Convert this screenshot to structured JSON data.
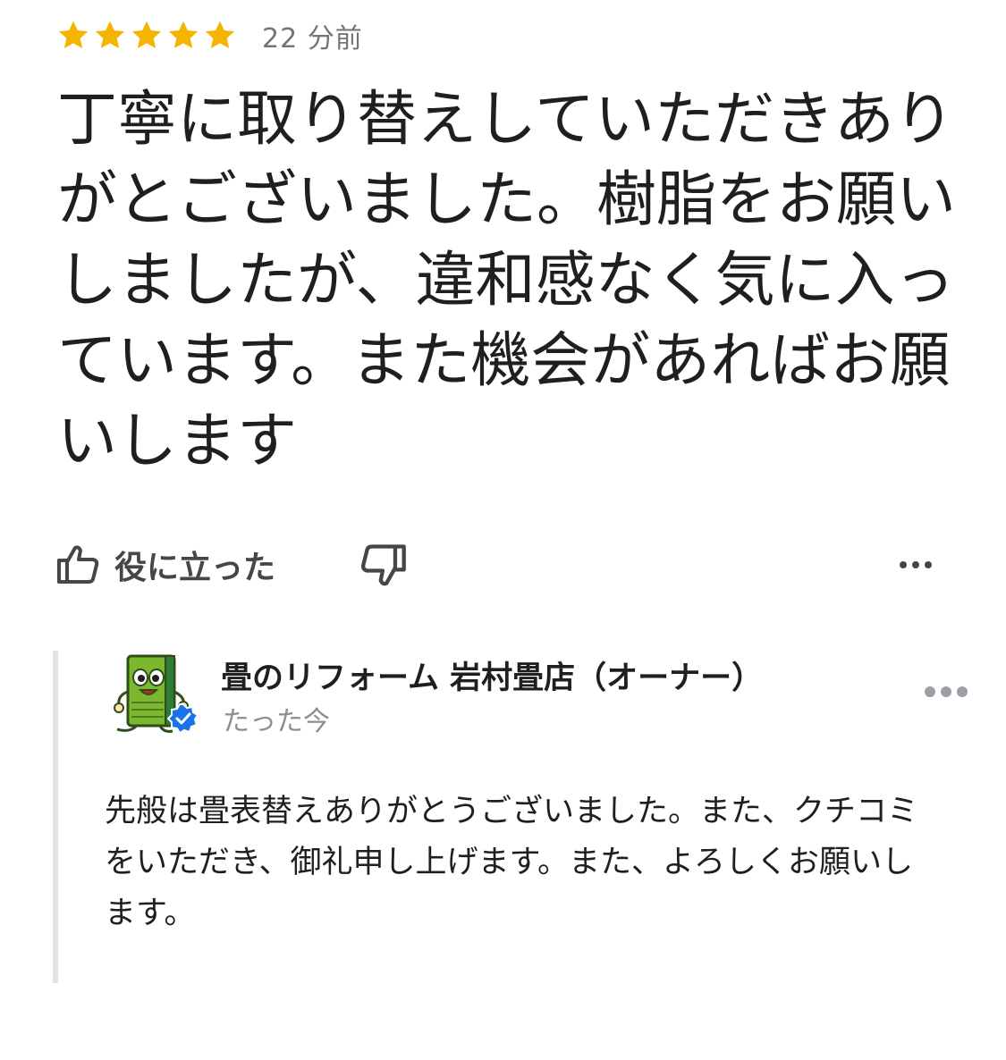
{
  "review": {
    "rating": 5,
    "rating_max": 5,
    "star_color": "#f4b400",
    "time_ago": "22 分前",
    "text": "丁寧に取り替えしていただきありがとございました。樹脂をお願いしましたが、違和感なく気に入っています。また機会があればお願いします"
  },
  "actions": {
    "helpful_label": "役に立った",
    "helpful_icon": "thumbs-up-icon",
    "dislike_icon": "thumbs-down-icon",
    "more_icon": "more-horizontal-icon"
  },
  "owner_reply": {
    "name": "畳のリフォーム 岩村畳店（オーナー）",
    "time": "たった今",
    "text": "先般は畳表替えありがとうございました。また、クチコミをいただき、御礼申し上げます。また、よろしくお願いします。",
    "avatar_icon": "tatami-mascot-avatar",
    "verified_icon": "verified-badge-icon",
    "verified_color": "#1a73e8",
    "more_icon": "more-horizontal-icon"
  }
}
